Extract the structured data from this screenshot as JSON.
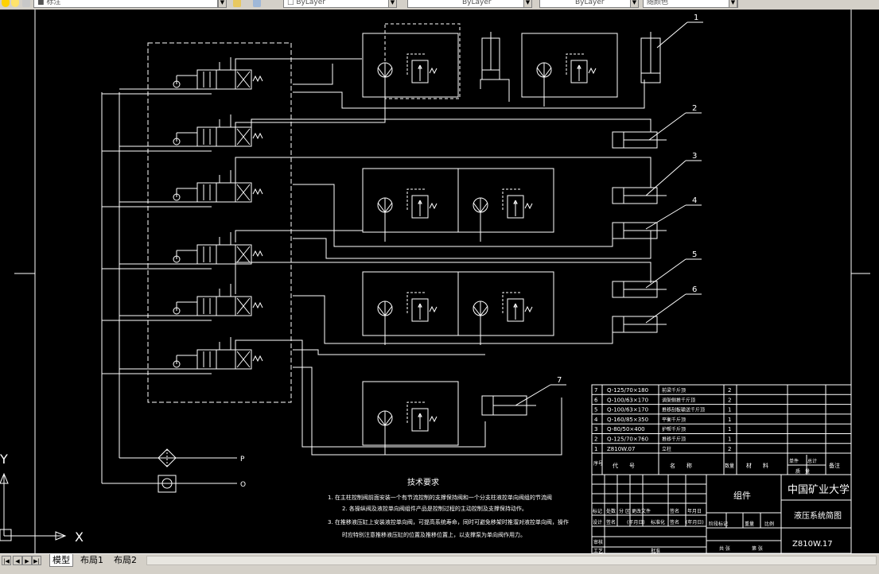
{
  "toolbar": {
    "layer_value": "标注",
    "color_value": "ByLayer",
    "linetype_value": "ByLayer",
    "lineweight_value": "ByLayer",
    "plotstyle_value": "随颜色"
  },
  "drawing": {
    "balloons": [
      "1",
      "2",
      "3",
      "4",
      "5",
      "6",
      "7"
    ],
    "port_labels": {
      "pressure": "P",
      "tank": "O"
    },
    "tech_title": "技术要求",
    "tech_lines": [
      "1. 在主柱控制阀前面安装一个有节流控制的支撑保持阀和一个分支柱液控单向阀组的节流阀",
      "2. 各操纵阀及液控单向阀组件产品是控制过程的主动控制及支撑保持动作。",
      "3. 在推移液压缸上安装液控单向阀，可提高系统寿命，同时可避免移架时推溜对液控单向阀，操作",
      "时应特别注意推移液压缸的位置及推移位置上，以支撑泵为单向阀作用力。"
    ],
    "bom": [
      {
        "no": "7",
        "code": "Q-125/70×180",
        "name": "前梁千斤顶",
        "qty": "2"
      },
      {
        "no": "6",
        "code": "Q-100/63×170",
        "name": "调架侧推千斤顶",
        "qty": "2"
      },
      {
        "no": "5",
        "code": "Q-100/63×170",
        "name": "推移刮板输送千斤顶",
        "qty": "1"
      },
      {
        "no": "4",
        "code": "Q-160/85×350",
        "name": "平衡千斤顶",
        "qty": "1"
      },
      {
        "no": "3",
        "code": "Q-80/50×400",
        "name": "护帮千斤顶",
        "qty": "1"
      },
      {
        "no": "2",
        "code": "Q-125/70×760",
        "name": "推移千斤顶",
        "qty": "1"
      },
      {
        "no": "1",
        "code": "Z810W.07",
        "name": "立柱",
        "qty": "2"
      }
    ],
    "bom_header": {
      "no": "序号",
      "code": "代　　号",
      "name": "名　　称",
      "qty": "数量",
      "material": "材　　料",
      "unit_weight": "单件",
      "total_weight": "总计",
      "weight": "质　量",
      "remark": "备注"
    },
    "title_block": {
      "assembly": "组件",
      "university": "中国矿业大学",
      "drawing_title": "液压系统简图",
      "drawing_no": "Z810W.17",
      "rev_row1": [
        "标记",
        "处数",
        "分",
        "区",
        "更改文件",
        "签名",
        "年月日"
      ],
      "rev_row2": [
        "设计",
        "签名",
        "(年月日)",
        "标准化",
        "签名",
        "(年月日)"
      ],
      "stage_row": [
        "阶段标记",
        "重量",
        "比例"
      ],
      "bottom_left": [
        "审核"
      ],
      "bottom_mid": [
        "工艺",
        "批准"
      ],
      "sheet_total": "共 张",
      "sheet_no": "第 张"
    },
    "ucs": {
      "x": "X",
      "y": "Y"
    }
  },
  "tabs": {
    "model": "模型",
    "layout1": "布局1",
    "layout2": "布局2"
  },
  "colors": {
    "background": "#000000",
    "lines": "#ffffff",
    "chrome": "#d4d0c8"
  }
}
